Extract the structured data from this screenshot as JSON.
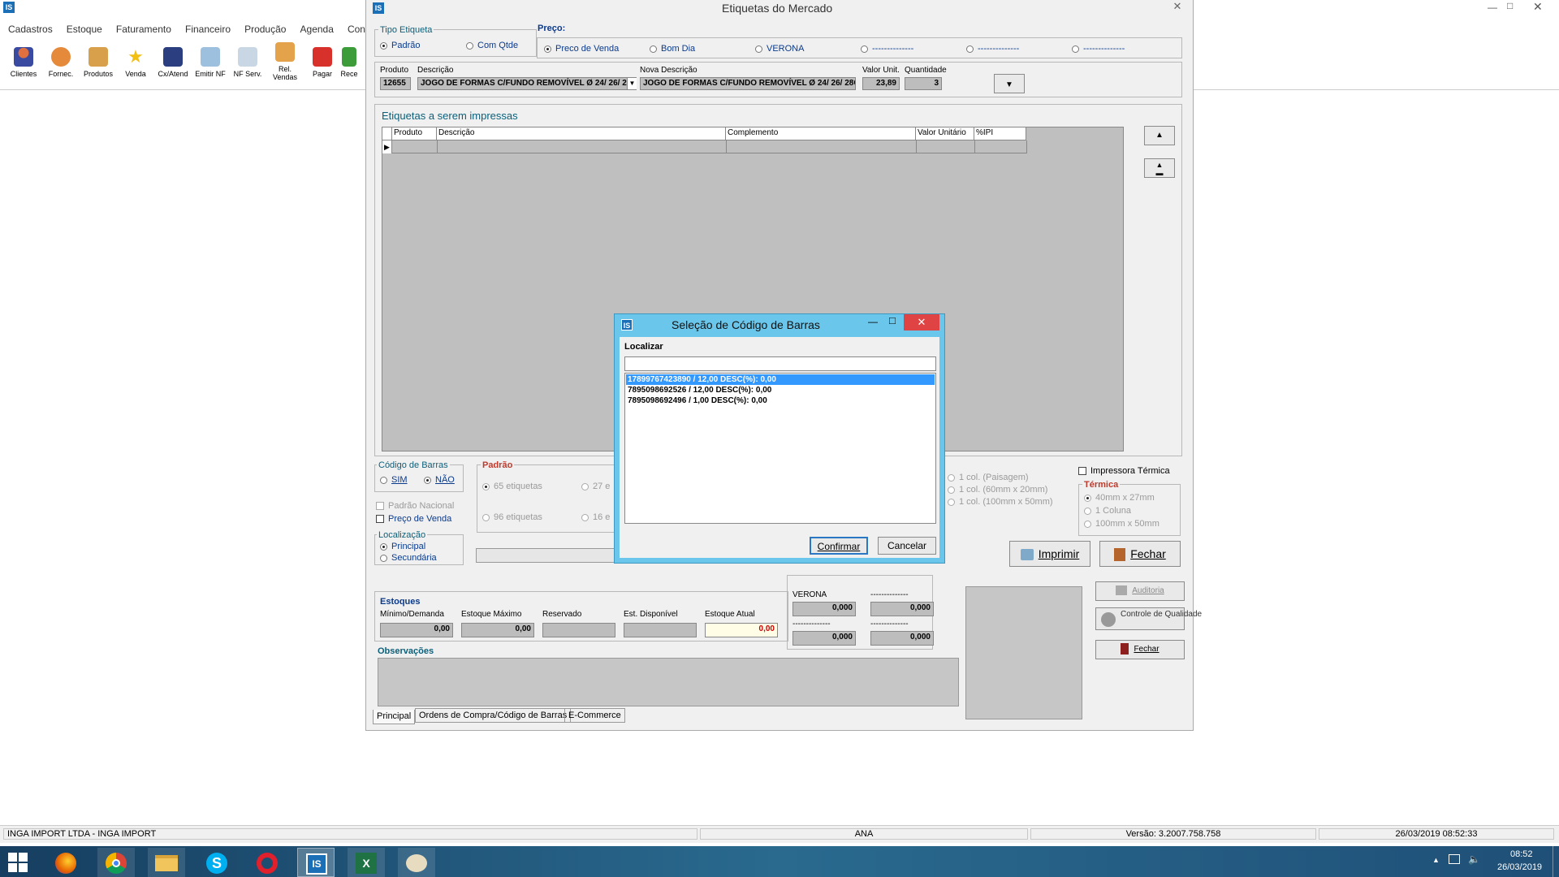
{
  "main_window": {
    "title": "Etiquetas do Mercado"
  },
  "background_app": {
    "menu": [
      "Cadastros",
      "Estoque",
      "Faturamento",
      "Financeiro",
      "Produção",
      "Agenda",
      "Contábil"
    ],
    "toolbar": [
      {
        "label": "Clientes",
        "icon": "person-icon"
      },
      {
        "label": "Fornec.",
        "icon": "truck-icon"
      },
      {
        "label": "Produtos",
        "icon": "box-icon"
      },
      {
        "label": "Venda",
        "icon": "star-icon"
      },
      {
        "label": "Cx/Atend",
        "icon": "register-icon"
      },
      {
        "label": "Emitir NF",
        "icon": "invoice-icon"
      },
      {
        "label": "NF Serv.",
        "icon": "service-invoice-icon"
      },
      {
        "label": "Rel. Vendas",
        "icon": "report-icon"
      },
      {
        "label": "Pagar",
        "icon": "pay-icon"
      },
      {
        "label": "Rece",
        "icon": "receive-icon"
      }
    ]
  },
  "tipo_etiqueta": {
    "title": "Tipo Etiqueta",
    "options": [
      "Padrão",
      "Com Qtde"
    ],
    "selected": "Padrão"
  },
  "preco": {
    "title": "Preço:",
    "options": [
      "Preco de Venda",
      "Bom Dia",
      "VERONA",
      "--------------",
      "--------------",
      "--------------"
    ],
    "selected": "Preco de Venda"
  },
  "product": {
    "produto_label": "Produto",
    "produto_value": "12655",
    "descricao_label": "Descrição",
    "descricao_value": "JOGO DE FORMAS C/FUNDO REMOVÍVEL Ø 24/ 26/ 28CM",
    "nova_descricao_label": "Nova Descrição",
    "nova_descricao_value": "JOGO DE FORMAS C/FUNDO REMOVÍVEL Ø 24/ 26/ 28CM",
    "valor_label": "Valor Unit.",
    "valor_value": "23,89",
    "qtd_label": "Quantidade",
    "qtd_value": "3"
  },
  "etiquetas": {
    "title": "Etiquetas a serem impressas",
    "columns": [
      "Produto",
      "Descrição",
      "Complemento",
      "Valor Unitário",
      "%IPI"
    ]
  },
  "codigo_barras": {
    "title": "Código de Barras",
    "options": [
      "SIM",
      "NÃO"
    ],
    "selected": "NÃO"
  },
  "checks": {
    "padrao_nacional": "Padrão Nacional",
    "preco_venda": "Preço de Venda"
  },
  "localizacao": {
    "title": "Localização",
    "options": [
      "Principal",
      "Secundária"
    ],
    "selected": "Principal"
  },
  "padrao": {
    "title": "Padrão",
    "options": [
      "65 etiquetas",
      "27 e",
      "96 etiquetas",
      "16 e"
    ]
  },
  "colunas": [
    "1 col. (Paisagem)",
    "1 col. (60mm x 20mm)",
    "1 col. (100mm x 50mm)"
  ],
  "impressora": {
    "label": "Impressora Térmica",
    "termica_title": "Térmica",
    "options": [
      "40mm x 27mm",
      "1 Coluna",
      "100mm x 50mm"
    ]
  },
  "buttons": {
    "imprimir": "Imprimir",
    "fechar": "Fechar"
  },
  "estoques": {
    "title": "Estoques",
    "labels": [
      "Mínimo/Demanda",
      "Estoque Máximo",
      "Reservado",
      "Est. Disponível",
      "Estoque Atual"
    ],
    "values": [
      "0,00",
      "0,00",
      "",
      "",
      "0,00"
    ]
  },
  "precos_bottom": {
    "labels": [
      "VERONA",
      "--------------",
      "--------------",
      "--------------"
    ],
    "values": [
      "0,000",
      "0,000",
      "0,000",
      "0,000"
    ]
  },
  "side_buttons": {
    "auditoria": "Auditoria",
    "controle": "Controle de Qualidade",
    "fechar": "Fechar"
  },
  "observacoes": {
    "title": "Observações"
  },
  "tabs": [
    "Principal",
    "Ordens de Compra/Código de Barras",
    "E-Commerce"
  ],
  "dialog": {
    "title": "Seleção de Código de Barras",
    "localizar_label": "Localizar",
    "search_value": "",
    "items": [
      "17899767423890 / 12,00  DESC(%): 0,00",
      "7895098692526 / 12,00  DESC(%): 0,00",
      "7895098692496 / 1,00  DESC(%): 0,00"
    ],
    "selected_index": 0,
    "confirm": "Confirmar",
    "cancel": "Cancelar"
  },
  "status_bar": [
    "INGA IMPORT LTDA - INGA IMPORT",
    "ANA",
    "Versão: 3.2007.758.758",
    "26/03/2019 08:52:33"
  ],
  "taskbar": {
    "time": "08:52",
    "date": "26/03/2019",
    "apps": [
      "firefox-icon",
      "chrome-icon",
      "file-explorer-icon",
      "skype-icon",
      "opera-icon",
      "is-app-icon",
      "excel-icon",
      "paint-icon"
    ]
  },
  "colors": {
    "selection": "#3399ff",
    "dialog_frame": "#6ac6ea",
    "close_red": "#e04343",
    "taskbar": "#1f4f77"
  }
}
